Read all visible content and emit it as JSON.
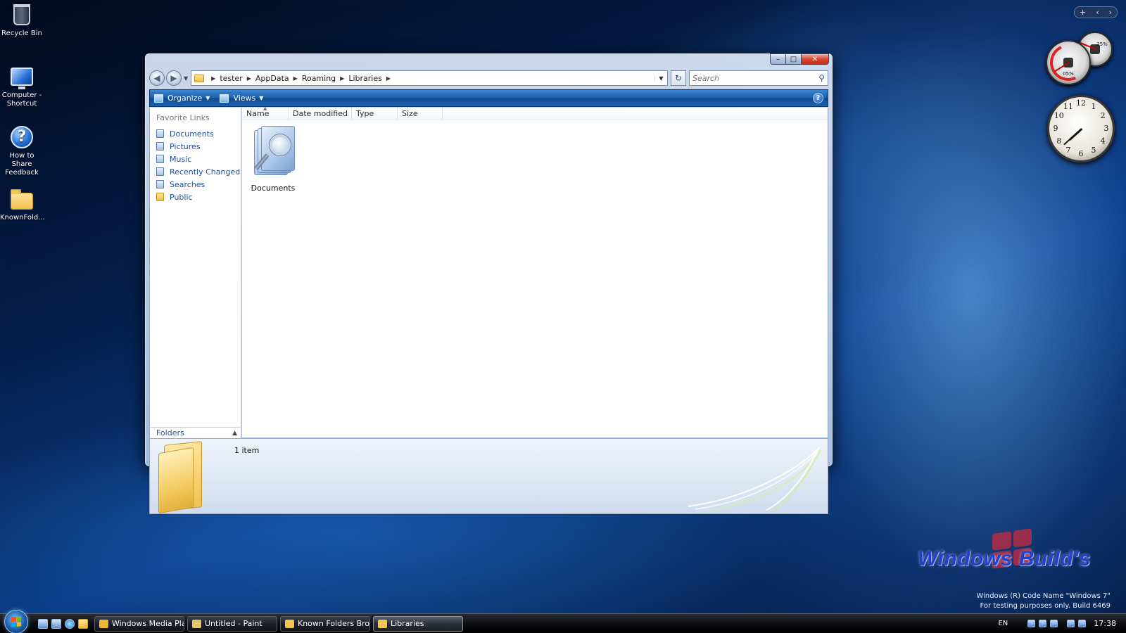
{
  "desktop": {
    "icons": [
      {
        "label": "Recycle Bin"
      },
      {
        "label": "Computer - Shortcut"
      },
      {
        "label": "How to Share Feedback"
      },
      {
        "label": "KnownFold..."
      }
    ]
  },
  "gadgets": {
    "toolbar": {
      "add": "+",
      "prev": "‹",
      "next": "›"
    },
    "cpu_meter": {
      "cpu_percent": "05%",
      "memory_percent": "25%",
      "cpu_value": 0.05,
      "memory_value": 0.25
    },
    "clock": {
      "numbers": [
        "12",
        "1",
        "2",
        "3",
        "4",
        "5",
        "6",
        "7",
        "8",
        "9",
        "10",
        "11"
      ],
      "hour": 7.6,
      "minute": 38
    }
  },
  "window": {
    "title": "Libraries",
    "caption": {
      "minimize": "–",
      "maximize": "□",
      "close": "✕"
    },
    "nav": {
      "back": "◀",
      "forward": "▶"
    },
    "breadcrumb": [
      "tester",
      "AppData",
      "Roaming",
      "Libraries"
    ],
    "refresh": "↻",
    "search": {
      "placeholder": "Search",
      "value": ""
    },
    "toolbar": {
      "organize_label": "Organize",
      "views_label": "Views",
      "help_label": "?"
    },
    "favorite_links_title": "Favorite Links",
    "favorite_links": [
      {
        "label": "Documents",
        "icon": "documents-icon"
      },
      {
        "label": "Pictures",
        "icon": "pictures-icon"
      },
      {
        "label": "Music",
        "icon": "music-icon"
      },
      {
        "label": "Recently Changed",
        "icon": "recent-icon"
      },
      {
        "label": "Searches",
        "icon": "search-folder-icon"
      },
      {
        "label": "Public",
        "icon": "folder-icon"
      }
    ],
    "folders_label": "Folders",
    "columns": [
      "Name",
      "Date modified",
      "Type",
      "Size"
    ],
    "items": [
      {
        "name": "Documents",
        "icon": "library-icon"
      }
    ],
    "details": {
      "count": "1 item"
    }
  },
  "taskbar": {
    "tasks": [
      {
        "label": "Windows Media Pla...",
        "color": "#f2b636"
      },
      {
        "label": "Untitled - Paint",
        "color": "#e5c46a"
      },
      {
        "label": "Known Folders Bro...",
        "color": "#f0c552"
      },
      {
        "label": "Libraries",
        "color": "#f0c552"
      }
    ],
    "language": "EN",
    "time": "17:38"
  },
  "watermark": {
    "line1": "Windows (R) Code Name \"Windows 7\"",
    "line2": "For testing purposes only. Build 6469",
    "brand": "Windows Build's"
  },
  "colors": {
    "accent": "#1e5da8",
    "link": "#1f4f9e",
    "desktop": "#0a3c86"
  }
}
